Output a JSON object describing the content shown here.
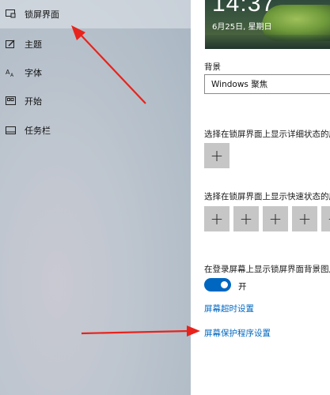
{
  "sidebar": {
    "items": [
      {
        "label": "锁屏界面",
        "icon": "lock-screen-icon",
        "selected": true
      },
      {
        "label": "主题",
        "icon": "theme-icon",
        "selected": false
      },
      {
        "label": "字体",
        "icon": "font-icon",
        "selected": false
      },
      {
        "label": "开始",
        "icon": "start-icon",
        "selected": false
      },
      {
        "label": "任务栏",
        "icon": "taskbar-icon",
        "selected": false
      }
    ]
  },
  "preview": {
    "time": "14:37",
    "date": "6月25日, 星期日"
  },
  "background": {
    "label": "背景",
    "value": "Windows 聚焦"
  },
  "detailed_status": {
    "label": "选择在锁屏界面上显示详细状态的应用",
    "plus": "+"
  },
  "quick_status": {
    "label": "选择在锁屏界面上显示快速状态的应用",
    "plus": "+"
  },
  "signin_background": {
    "label": "在登录屏幕上显示锁屏界面背景图片",
    "toggle_state": "开",
    "enabled": true
  },
  "links": {
    "screen_timeout": "屏幕超时设置",
    "screen_saver": "屏幕保护程序设置"
  },
  "colors": {
    "accent": "#0067c0",
    "annotation_arrow": "#e8231c"
  }
}
